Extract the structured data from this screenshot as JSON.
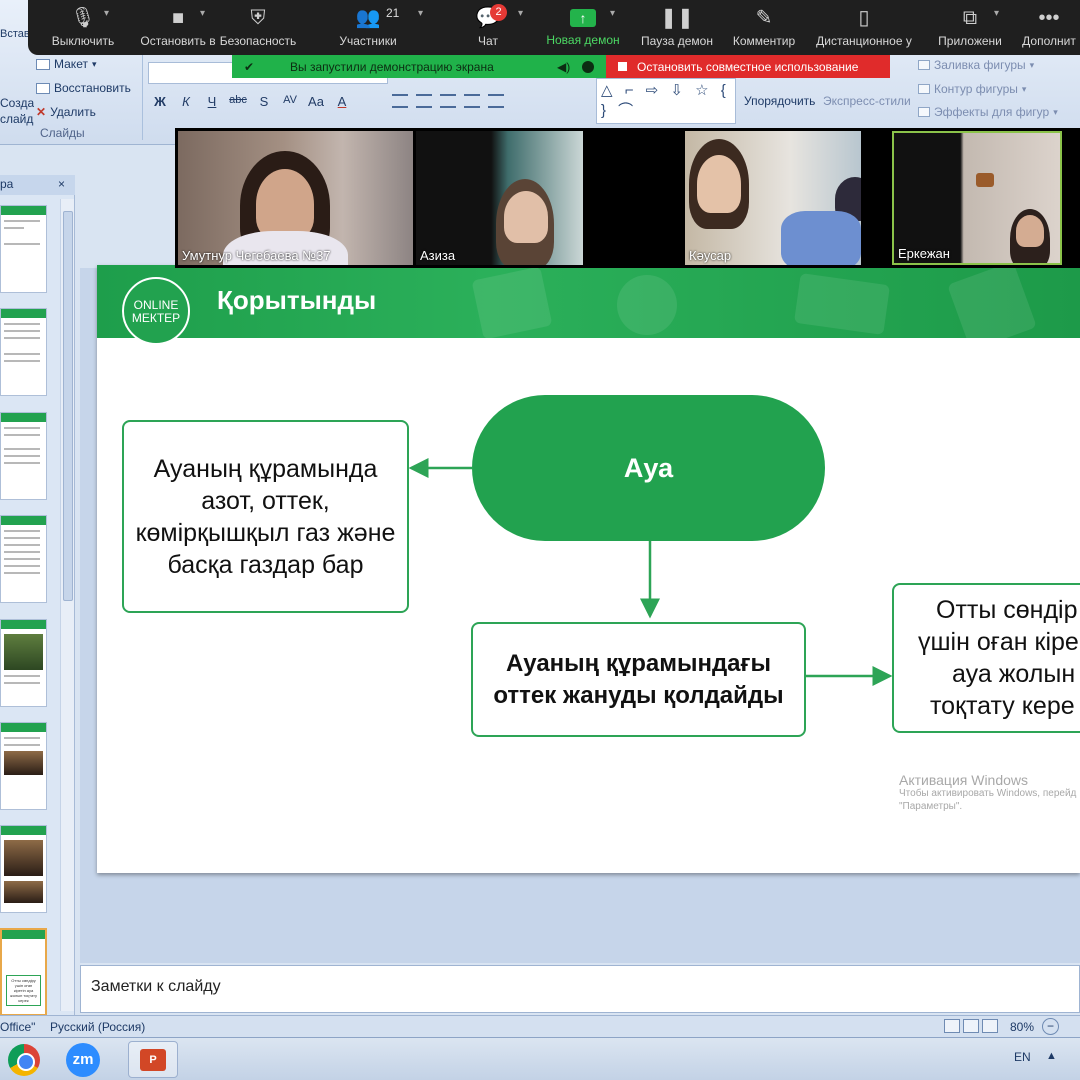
{
  "ribbon": {
    "tab_stub": "Встав",
    "new_slide": "Создать слайд",
    "layout": "Макет",
    "reset": "Восстановить",
    "delete": "Удалить",
    "group_slides": "Слайды",
    "font_buttons": [
      "Ж",
      "К",
      "Ч",
      "abc",
      "S",
      "AV",
      "Aa",
      "A"
    ],
    "shapes_glyphs": "△ ⌐ ⇨ ⇩ ☆ { } ⌒",
    "arrange": "Упорядочить",
    "quick_styles": "Экспресс-стили",
    "shape_fill": "Заливка фигуры",
    "shape_outline": "Контур фигуры",
    "shape_effects": "Эффекты для фигур"
  },
  "zoom_toolbar": {
    "items": [
      {
        "label": "Выключить",
        "icon": "microphone-icon"
      },
      {
        "label": "Остановить в",
        "icon": "video-camera-icon"
      },
      {
        "label": "Безопасность",
        "icon": "shield-icon"
      },
      {
        "label": "Участники",
        "icon": "participants-icon",
        "count": "21"
      },
      {
        "label": "Чат",
        "icon": "chat-icon",
        "badge": "2"
      },
      {
        "label": "Новая демон",
        "icon": "share-screen-icon"
      },
      {
        "label": "Пауза демон",
        "icon": "pause-icon"
      },
      {
        "label": "Комментир",
        "icon": "pen-icon"
      },
      {
        "label": "Дистанционное у",
        "icon": "mouse-icon"
      },
      {
        "label": "Приложени",
        "icon": "apps-icon"
      },
      {
        "label": "Дополнит",
        "icon": "more-icon"
      }
    ],
    "sharing_banner": "Вы запустили демонстрацию экрана",
    "stop_share": "Остановить совместное использование"
  },
  "participants": [
    {
      "name": "Умутнур Чегебаева №37"
    },
    {
      "name": "Азиза"
    },
    {
      "name": "Кәусар"
    },
    {
      "name": "Еркежан"
    }
  ],
  "slides_panel": {
    "tab": "ра",
    "close": "×",
    "selected_thumb_text": "Отты сөндіру үшін оған кіретін ауа жолын тоқтату керек"
  },
  "slide": {
    "logo_line1": "ONLINE",
    "logo_line2": "МЕКТЕР",
    "title": "Қорытынды",
    "center": "Ауа",
    "left_box": "Ауаның құрамында азот, оттек, көмірқышқыл газ және басқа газдар бар",
    "bottom_box": "Ауаның құрамындағы оттек жануды қолдайды",
    "right_box_lines": [
      "Отты сөндір",
      "үшін оған кіре",
      "ауа жолын",
      "тоқтату кере"
    ],
    "watermark_title": "Активация Windows",
    "watermark_line1": "Чтобы активировать Windows, перейд",
    "watermark_line2": "\"Параметры\"."
  },
  "notes": {
    "placeholder": "Заметки к слайду"
  },
  "status_bar": {
    "theme": "Office\"",
    "language": "Русский (Россия)",
    "zoom": "80%"
  },
  "taskbar": {
    "language": "EN",
    "zoom_app": "zm"
  },
  "colors": {
    "slide_green": "#22a24f",
    "zoom_toolbar": "#1f1f1f",
    "share_green": "#20b24a",
    "stop_red": "#e02b2b"
  }
}
